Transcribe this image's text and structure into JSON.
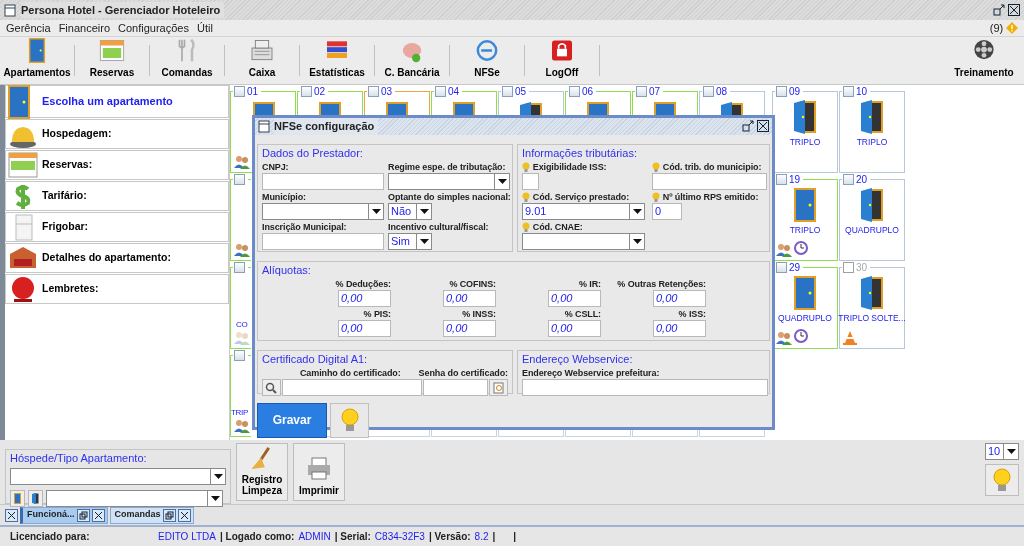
{
  "window": {
    "title": "Persona Hotel - Gerenciador Hoteleiro"
  },
  "menu": [
    {
      "label": "Gerência"
    },
    {
      "label": "Financeiro"
    },
    {
      "label": "Configurações"
    },
    {
      "label": "Útil"
    }
  ],
  "notifications": {
    "count": "(9)"
  },
  "toolbar": [
    {
      "label": "Apartamentos"
    },
    {
      "label": "Reservas"
    },
    {
      "label": "Comandas"
    },
    {
      "label": "Caixa"
    },
    {
      "label": "Estatísticas"
    },
    {
      "label": "C. Bancária"
    },
    {
      "label": "NFSe"
    },
    {
      "label": "LogOff"
    }
  ],
  "toolbar_right": {
    "label": "Treinamento"
  },
  "sidebar": [
    {
      "label": "Escolha um apartamento",
      "selected": true
    },
    {
      "label": "Hospedagem:",
      "selected": false
    },
    {
      "label": "Reservas:",
      "selected": false
    },
    {
      "label": "Tarifário:",
      "selected": false
    },
    {
      "label": "Frigobar:",
      "selected": false
    },
    {
      "label": "Detalhes do apartamento:",
      "selected": false
    },
    {
      "label": "Lembretes:",
      "selected": false
    }
  ],
  "rooms": [
    [
      {
        "kind": "top",
        "number": "01",
        "color": "#8fdc4e",
        "door_open": false,
        "guests": true
      },
      {
        "kind": "top",
        "number": "02",
        "color": "#8fdc4e",
        "door_open": false
      },
      {
        "kind": "top",
        "number": "03",
        "color": "#f0a050",
        "door_open": false
      },
      {
        "kind": "top",
        "number": "04",
        "color": "#8fdc4e",
        "door_open": false
      },
      {
        "kind": "top",
        "number": "05",
        "color": "#b8c8d8",
        "door_open": true
      },
      {
        "kind": "top",
        "number": "06",
        "color": "#8fdc4e",
        "door_open": false
      },
      {
        "kind": "top",
        "number": "07",
        "color": "#8fdc4e",
        "door_open": false
      },
      {
        "kind": "top",
        "number": "08",
        "color": "#b8c8d8",
        "door_open": true
      },
      {
        "kind": "room",
        "number": "09",
        "label": "TRIPLO",
        "color": "#b8c8d8",
        "door_open": true
      },
      {
        "kind": "room",
        "number": "10",
        "label": "TRIPLO",
        "color": "#b8c8d8",
        "door_open": true
      }
    ],
    [
      {
        "kind": "covered",
        "color": "#8fdc4e",
        "guests": true
      },
      {
        "kind": "hidden"
      },
      {
        "kind": "hidden"
      },
      {
        "kind": "hidden"
      },
      {
        "kind": "hidden"
      },
      {
        "kind": "hidden"
      },
      {
        "kind": "hidden"
      },
      {
        "kind": "hidden"
      },
      {
        "kind": "room",
        "number": "19",
        "label": "TRIPLO",
        "color": "#8fdc4e",
        "door_open": false,
        "guests": true,
        "alarm": true
      },
      {
        "kind": "room",
        "number": "20",
        "label": "QUADRUPLO",
        "color": "#b8c8d8",
        "door_open": true
      }
    ],
    [
      {
        "kind": "covered",
        "label": "CO",
        "color": "#8fdc4e",
        "guests": true,
        "guests_dimmed": true
      },
      {
        "kind": "hidden"
      },
      {
        "kind": "hidden"
      },
      {
        "kind": "hidden"
      },
      {
        "kind": "hidden"
      },
      {
        "kind": "hidden"
      },
      {
        "kind": "hidden"
      },
      {
        "kind": "hidden"
      },
      {
        "kind": "room",
        "number": "29",
        "label": "QUADRUPLO",
        "color": "#8fdc4e",
        "door_open": false,
        "guests": true,
        "alarm": true
      },
      {
        "kind": "room",
        "number": "30",
        "label": "TRIPLO SOLTE...",
        "color": "#b8c8d8",
        "door_open": true,
        "disabled": true,
        "maintenance": true
      }
    ],
    [
      {
        "kind": "covered",
        "label": "TRIP",
        "color": "#8fdc4e",
        "guests": true
      },
      {
        "kind": "hidden"
      },
      {
        "kind": "hidden"
      },
      {
        "kind": "hidden"
      },
      {
        "kind": "hidden"
      },
      {
        "kind": "hidden"
      },
      {
        "kind": "hidden"
      },
      {
        "kind": "hidden"
      },
      {
        "kind": "empty"
      },
      {
        "kind": "empty"
      }
    ]
  ],
  "dialog": {
    "title": "NFSe configuração",
    "prestador": {
      "legend": "Dados do Prestador:",
      "cnpj": {
        "label": "CNPJ:"
      },
      "regime": {
        "label": "Regime espe. de tributação:"
      },
      "municipio": {
        "label": "Município:"
      },
      "optante": {
        "label": "Optante do simples nacional:",
        "value": "Não"
      },
      "inscricao": {
        "label": "Inscrição Municipal:"
      },
      "incentivo": {
        "label": "Incentivo cultural/fiscal:",
        "value": "Sim"
      }
    },
    "tributarias": {
      "legend": "Informações tributárias:",
      "exigibilidade": {
        "label": "Exigibilidade ISS:"
      },
      "cod_trib": {
        "label": "Cód. trib. do municipio:"
      },
      "cod_servico": {
        "label": "Cód. Serviço prestado:",
        "value": "9.01"
      },
      "ultimo_rps": {
        "label": "Nº último RPS emitido:",
        "value": "0"
      },
      "cnae": {
        "label": "Cód. CNAE:"
      }
    },
    "aliquotas": {
      "legend": "Alíquotas:",
      "fields": [
        {
          "label": "% Deduções:",
          "value": "0,00"
        },
        {
          "label": "% COFINS:",
          "value": "0,00"
        },
        {
          "label": "% IR:",
          "value": "0,00"
        },
        {
          "label": "% Outras Retenções:",
          "value": "0,00"
        },
        {
          "label": "% PIS:",
          "value": "0,00"
        },
        {
          "label": "% INSS:",
          "value": "0,00"
        },
        {
          "label": "% CSLL:",
          "value": "0,00"
        },
        {
          "label": "% ISS:",
          "value": "0,00"
        }
      ]
    },
    "certificado": {
      "legend": "Certificado Digital A1:",
      "path_label": "Caminho do certificado:",
      "password_label": "Senha do certificado:"
    },
    "webservice": {
      "legend": "Endereço Webservice:",
      "label": "Endereço Webservice prefeitura:"
    },
    "save_button": "Gravar"
  },
  "guest_panel": {
    "legend": "Hóspede/Tipo Apartamento:"
  },
  "actions": [
    {
      "label": "Registro Limpeza"
    },
    {
      "label": "Imprimir"
    }
  ],
  "page_size": {
    "value": "10"
  },
  "taskbar": [
    {
      "label": "Funcioná...",
      "selected": true
    },
    {
      "label": "Comandas",
      "selected": false
    }
  ],
  "status_bar": [
    {
      "kind": "label",
      "text": "Licenciado para:"
    },
    {
      "kind": "value",
      "text": "EDITO LTDA"
    },
    {
      "kind": "label",
      "text": "| Logado como:"
    },
    {
      "kind": "value",
      "text": "ADMIN"
    },
    {
      "kind": "label",
      "text": "| Serial:"
    },
    {
      "kind": "value",
      "text": "C834-32F3"
    },
    {
      "kind": "label",
      "text": "| Versão:"
    },
    {
      "kind": "value",
      "text": "8.2"
    },
    {
      "kind": "label",
      "text": "|"
    },
    {
      "kind": "label",
      "text": "|"
    }
  ]
}
